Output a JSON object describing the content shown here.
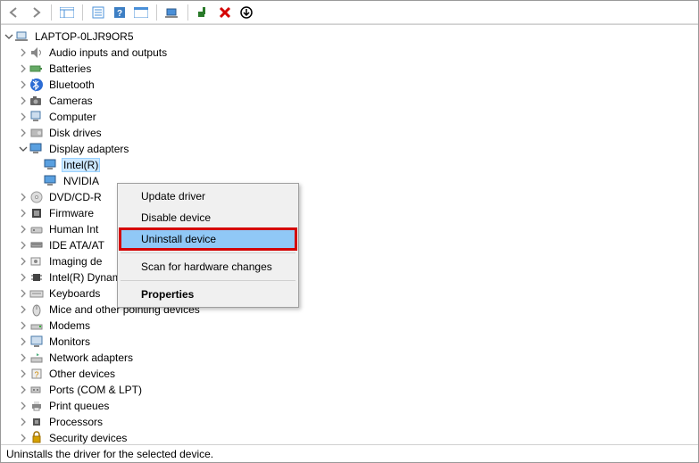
{
  "toolbar": {
    "back": "←",
    "forward": "→",
    "icons": [
      "show-hidden",
      "properties",
      "help",
      "update",
      "scan",
      "monitor",
      "add",
      "remove",
      "more"
    ]
  },
  "tree": {
    "root": {
      "label": "LAPTOP-0LJR9OR5",
      "expanded": true
    },
    "items": [
      {
        "label": "Audio inputs and outputs",
        "expanded": false,
        "icon": "audio"
      },
      {
        "label": "Batteries",
        "expanded": false,
        "icon": "battery"
      },
      {
        "label": "Bluetooth",
        "expanded": false,
        "icon": "bluetooth"
      },
      {
        "label": "Cameras",
        "expanded": false,
        "icon": "camera"
      },
      {
        "label": "Computer",
        "expanded": false,
        "icon": "computer"
      },
      {
        "label": "Disk drives",
        "expanded": false,
        "icon": "disk"
      },
      {
        "label": "Display adapters",
        "expanded": true,
        "icon": "display",
        "children": [
          {
            "label": "Intel(R)",
            "icon": "display",
            "selected": true
          },
          {
            "label": "NVIDIA",
            "icon": "display"
          }
        ]
      },
      {
        "label": "DVD/CD-R",
        "expanded": false,
        "icon": "dvd",
        "truncated": true
      },
      {
        "label": "Firmware",
        "expanded": false,
        "icon": "firmware"
      },
      {
        "label": "Human Int",
        "expanded": false,
        "icon": "hid",
        "truncated": true
      },
      {
        "label": "IDE ATA/AT",
        "expanded": false,
        "icon": "ide",
        "truncated": true
      },
      {
        "label": "Imaging de",
        "expanded": false,
        "icon": "imaging",
        "truncated": true
      },
      {
        "label": "Intel(R) Dynamic Platform and Thermal Framework",
        "expanded": false,
        "icon": "chip"
      },
      {
        "label": "Keyboards",
        "expanded": false,
        "icon": "keyboard"
      },
      {
        "label": "Mice and other pointing devices",
        "expanded": false,
        "icon": "mouse"
      },
      {
        "label": "Modems",
        "expanded": false,
        "icon": "modem"
      },
      {
        "label": "Monitors",
        "expanded": false,
        "icon": "monitor"
      },
      {
        "label": "Network adapters",
        "expanded": false,
        "icon": "network"
      },
      {
        "label": "Other devices",
        "expanded": false,
        "icon": "other"
      },
      {
        "label": "Ports (COM & LPT)",
        "expanded": false,
        "icon": "port"
      },
      {
        "label": "Print queues",
        "expanded": false,
        "icon": "printer"
      },
      {
        "label": "Processors",
        "expanded": false,
        "icon": "cpu"
      },
      {
        "label": "Security devices",
        "expanded": false,
        "icon": "security",
        "cut": true
      }
    ]
  },
  "context_menu": {
    "items": [
      {
        "label": "Update driver",
        "type": "item"
      },
      {
        "label": "Disable device",
        "type": "item"
      },
      {
        "label": "Uninstall device",
        "type": "item",
        "hover": true,
        "highlight": true
      },
      {
        "type": "sep"
      },
      {
        "label": "Scan for hardware changes",
        "type": "item"
      },
      {
        "type": "sep"
      },
      {
        "label": "Properties",
        "type": "item",
        "bold": true
      }
    ]
  },
  "status": "Uninstalls the driver for the selected device."
}
